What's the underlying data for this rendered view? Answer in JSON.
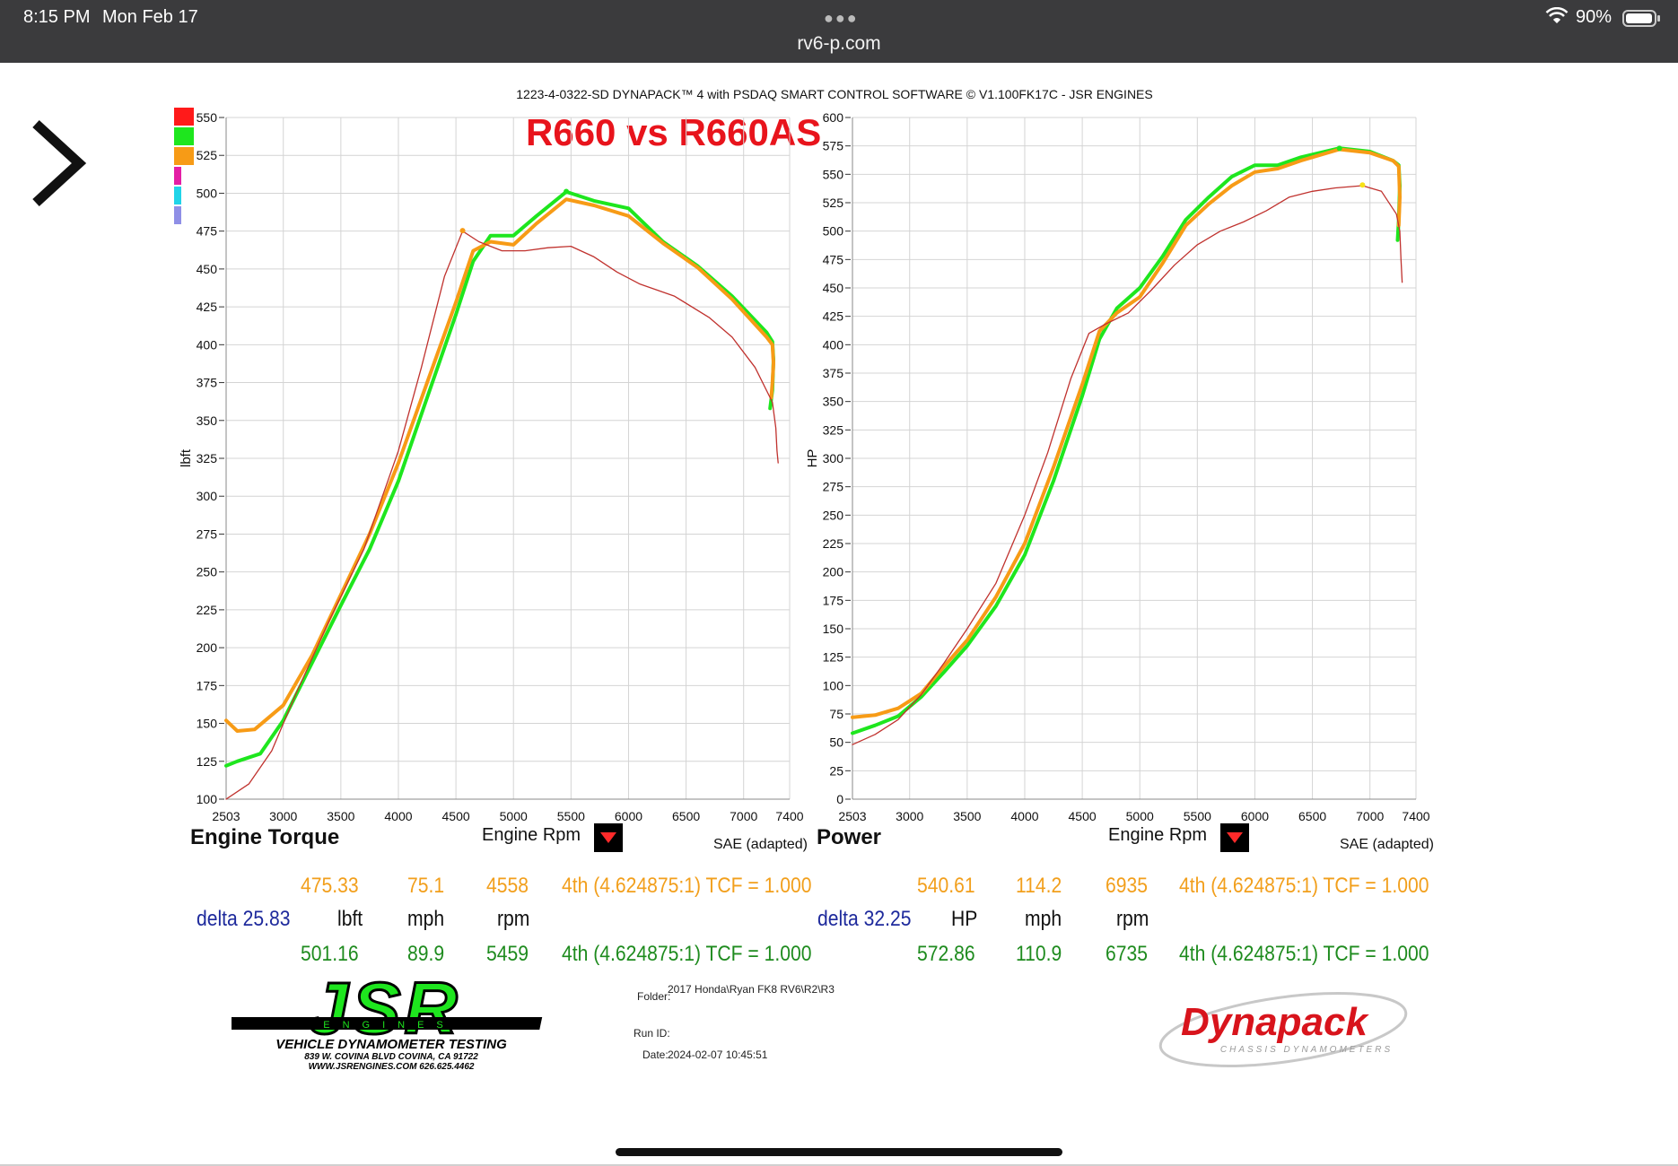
{
  "status": {
    "time": "8:15 PM",
    "date": "Mon Feb 17",
    "url": "rv6-p.com",
    "battery": "90%"
  },
  "header": {
    "software_line": "1223-4-0322-SD DYNAPACK™ 4 with PSDAQ SMART CONTROL SOFTWARE © V1.100FK17C - JSR ENGINES",
    "headline": "R660 vs R660AS"
  },
  "legend_colors": [
    "#ff1a1a",
    "#1ee61e",
    "#f79b16",
    "#e41ea5",
    "#20d4e8",
    "#8f8fe6"
  ],
  "chart_data": [
    {
      "type": "line",
      "title": "Engine Torque",
      "xlabel": "Engine Rpm",
      "ylabel": "lbft",
      "scale_label": "SAE (adapted)",
      "xlim": [
        2503,
        7400
      ],
      "ylim": [
        100,
        550
      ],
      "xticks": [
        2503,
        3000,
        3500,
        4000,
        4500,
        5000,
        5500,
        6000,
        6500,
        7000,
        7400
      ],
      "yticks": [
        100,
        125,
        150,
        175,
        200,
        225,
        250,
        275,
        300,
        325,
        350,
        375,
        400,
        425,
        450,
        475,
        500,
        525,
        550
      ],
      "grid": true,
      "series": [
        {
          "color": "#1ee61e",
          "width": 4,
          "x": [
            2503,
            2600,
            2800,
            3000,
            3250,
            3500,
            3750,
            4000,
            4250,
            4500,
            4650,
            4800,
            5000,
            5200,
            5459,
            5700,
            6000,
            6300,
            6600,
            6900,
            7200,
            7250,
            7260,
            7250,
            7230
          ],
          "y": [
            122,
            125,
            130,
            152,
            190,
            228,
            265,
            310,
            365,
            420,
            455,
            472,
            472,
            485,
            501,
            495,
            490,
            468,
            452,
            432,
            408,
            402,
            390,
            370,
            358
          ]
        },
        {
          "color": "#f79b16",
          "width": 4,
          "x": [
            2503,
            2600,
            2750,
            3000,
            3250,
            3500,
            3750,
            4000,
            4250,
            4500,
            4650,
            4800,
            5000,
            5200,
            5459,
            5700,
            6000,
            6300,
            6600,
            6900,
            7200,
            7250,
            7260,
            7250,
            7240
          ],
          "y": [
            152,
            145,
            146,
            162,
            195,
            235,
            275,
            322,
            375,
            428,
            462,
            468,
            466,
            480,
            496,
            492,
            485,
            467,
            451,
            430,
            405,
            400,
            388,
            375,
            365
          ]
        },
        {
          "color": "#c0322e",
          "width": 1.3,
          "x": [
            2503,
            2700,
            2900,
            3100,
            3400,
            3700,
            4000,
            4200,
            4400,
            4558,
            4700,
            4900,
            5100,
            5300,
            5500,
            5700,
            5900,
            6100,
            6400,
            6700,
            6900,
            7100,
            7250,
            7280,
            7290,
            7300
          ],
          "y": [
            100,
            110,
            132,
            168,
            218,
            265,
            330,
            385,
            445,
            475,
            468,
            462,
            462,
            464,
            465,
            458,
            448,
            440,
            432,
            418,
            405,
            385,
            362,
            345,
            330,
            322
          ]
        }
      ],
      "cursor_points": [
        {
          "x": 4558,
          "y": 475.33,
          "color": "#f79b16"
        },
        {
          "x": 5459,
          "y": 501.16,
          "color": "#1ee61e"
        }
      ],
      "readout": {
        "row1": {
          "value": "475.33",
          "speed": "75.1",
          "rpm": "4558",
          "gear": "4th (4.624875:1) TCF = 1.000"
        },
        "row2": {
          "delta": "delta 25.83",
          "unit": "lbft",
          "speed_unit": "mph",
          "rpm_unit": "rpm"
        },
        "row3": {
          "value": "501.16",
          "speed": "89.9",
          "rpm": "5459",
          "gear": "4th (4.624875:1) TCF = 1.000"
        }
      }
    },
    {
      "type": "line",
      "title": "Power",
      "xlabel": "Engine Rpm",
      "ylabel": "HP",
      "scale_label": "SAE (adapted)",
      "xlim": [
        2503,
        7400
      ],
      "ylim": [
        0,
        600
      ],
      "xticks": [
        2503,
        3000,
        3500,
        4000,
        4500,
        5000,
        5500,
        6000,
        6500,
        7000,
        7400
      ],
      "yticks": [
        0,
        25,
        50,
        75,
        100,
        125,
        150,
        175,
        200,
        225,
        250,
        275,
        300,
        325,
        350,
        375,
        400,
        425,
        450,
        475,
        500,
        525,
        550,
        575,
        600
      ],
      "grid": true,
      "series": [
        {
          "color": "#1ee61e",
          "width": 4,
          "x": [
            2503,
            2700,
            2900,
            3100,
            3300,
            3500,
            3750,
            4000,
            4250,
            4500,
            4650,
            4800,
            5000,
            5200,
            5400,
            5600,
            5800,
            6000,
            6200,
            6400,
            6735,
            7000,
            7200,
            7250,
            7260,
            7250,
            7240
          ],
          "y": [
            58,
            65,
            73,
            90,
            112,
            135,
            170,
            215,
            280,
            355,
            405,
            432,
            450,
            478,
            510,
            530,
            548,
            558,
            558,
            565,
            573,
            570,
            562,
            558,
            540,
            510,
            492
          ]
        },
        {
          "color": "#f79b16",
          "width": 4,
          "x": [
            2503,
            2700,
            2900,
            3100,
            3300,
            3500,
            3750,
            4000,
            4250,
            4500,
            4650,
            4800,
            5000,
            5200,
            5400,
            5600,
            5800,
            6000,
            6200,
            6400,
            6735,
            7000,
            7200,
            7250,
            7260,
            7250
          ],
          "y": [
            72,
            74,
            80,
            93,
            117,
            140,
            178,
            225,
            292,
            365,
            412,
            428,
            442,
            472,
            505,
            524,
            540,
            552,
            555,
            562,
            572,
            569,
            562,
            557,
            530,
            505
          ]
        },
        {
          "color": "#c0322e",
          "width": 1.3,
          "x": [
            2503,
            2700,
            2900,
            3100,
            3300,
            3500,
            3750,
            4000,
            4200,
            4400,
            4558,
            4700,
            4900,
            5100,
            5300,
            5500,
            5700,
            5900,
            6100,
            6300,
            6500,
            6700,
            6935,
            7100,
            7230,
            7260,
            7270,
            7280
          ],
          "y": [
            48,
            57,
            70,
            92,
            120,
            150,
            190,
            250,
            305,
            370,
            410,
            418,
            428,
            448,
            470,
            488,
            500,
            508,
            518,
            530,
            535,
            538,
            540,
            535,
            515,
            500,
            475,
            455
          ]
        }
      ],
      "cursor_points": [
        {
          "x": 6935,
          "y": 540.61,
          "color": "#f7e116"
        },
        {
          "x": 6735,
          "y": 572.86,
          "color": "#1ee61e"
        }
      ],
      "readout": {
        "row1": {
          "value": "540.61",
          "speed": "114.2",
          "rpm": "6935",
          "gear": "4th (4.624875:1) TCF = 1.000"
        },
        "row2": {
          "delta": "delta 32.25",
          "unit": "HP",
          "speed_unit": "mph",
          "rpm_unit": "rpm"
        },
        "row3": {
          "value": "572.86",
          "speed": "110.9",
          "rpm": "6735",
          "gear": "4th (4.624875:1) TCF = 1.000"
        }
      }
    }
  ],
  "footer": {
    "jsr": {
      "word": "JSR",
      "band": "ENGINES",
      "tagline": "VEHICLE DYNAMOMETER TESTING",
      "address": "839 W. COVINA BLVD COVINA, CA 91722",
      "web": "WWW.JSRENGINES.COM 626.625.4462"
    },
    "folder_label": "Folder:",
    "folder": "2017 Honda\\Ryan FK8 RV6\\R2\\R3",
    "runid_label": "Run ID:",
    "date_label": "Date:",
    "date": "2024-02-07 10:45:51",
    "dynapack": {
      "word": "Dynapack",
      "sub": "CHASSIS DYNAMOMETERS"
    }
  }
}
